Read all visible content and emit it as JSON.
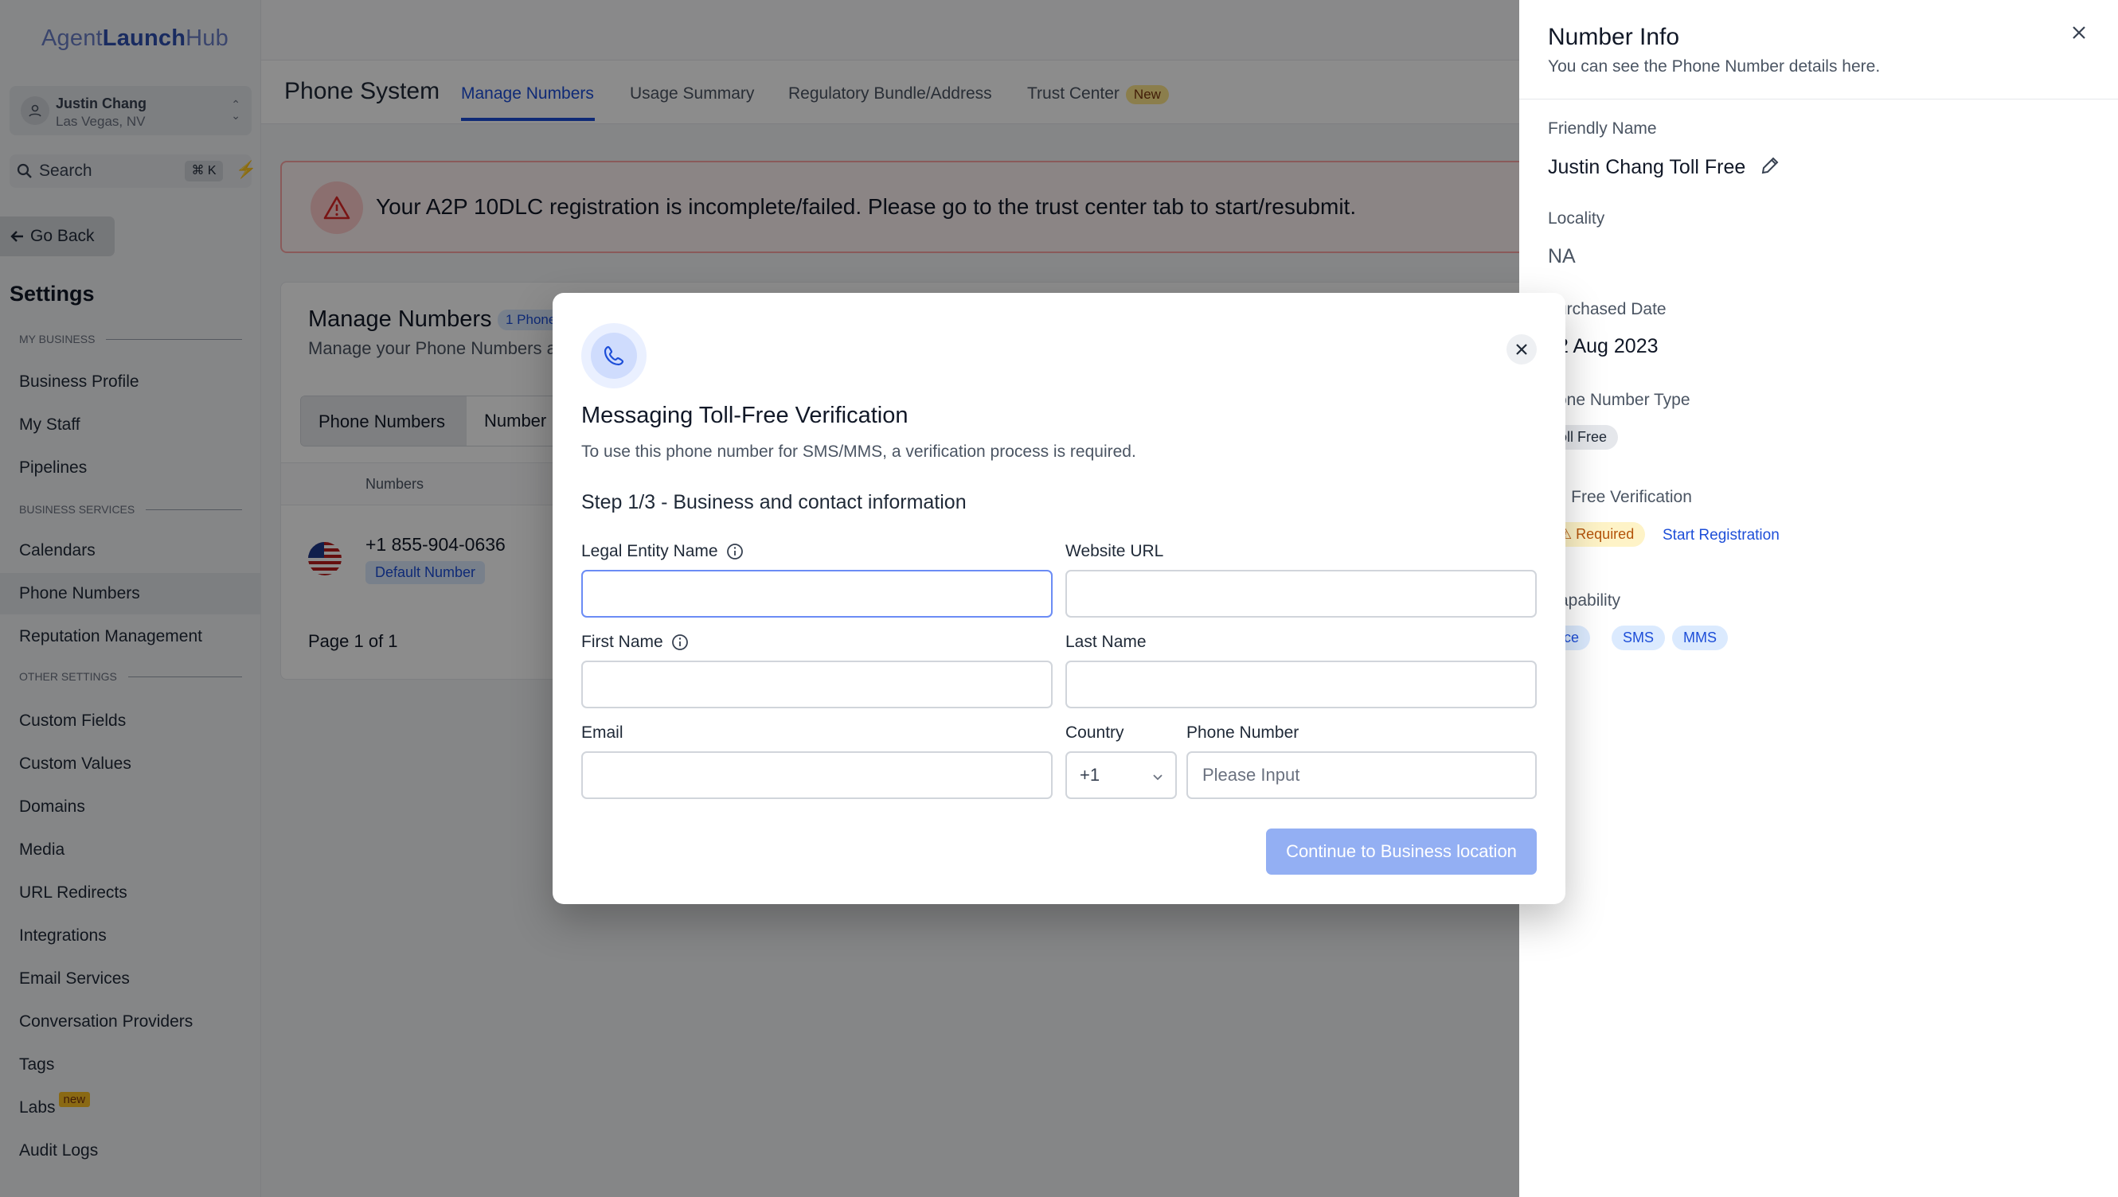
{
  "sidebar": {
    "logo_prefix": "Agent",
    "logo_strong": "Launch",
    "logo_suffix": "Hub",
    "account": {
      "name": "Justin Chang",
      "location": "Las Vegas, NV"
    },
    "search": {
      "label": "Search",
      "shortcut": "⌘ K"
    },
    "go_back": "Go Back",
    "title": "Settings",
    "sections": {
      "my_business": "MY BUSINESS",
      "business_services": "BUSINESS SERVICES",
      "other_settings": "OTHER SETTINGS"
    },
    "items": {
      "business_profile": "Business Profile",
      "my_staff": "My Staff",
      "pipelines": "Pipelines",
      "calendars": "Calendars",
      "phone_numbers": "Phone Numbers",
      "reputation": "Reputation Management",
      "custom_fields": "Custom Fields",
      "custom_values": "Custom Values",
      "domains": "Domains",
      "media": "Media",
      "url_redirects": "URL Redirects",
      "integrations": "Integrations",
      "email_services": "Email Services",
      "conversation_providers": "Conversation Providers",
      "tags": "Tags",
      "labs": "Labs",
      "labs_badge": "new",
      "audit_logs": "Audit Logs"
    }
  },
  "header": {
    "title": "Phone System",
    "tabs": {
      "manage": "Manage Numbers",
      "usage": "Usage Summary",
      "regulatory": "Regulatory Bundle/Address",
      "trust": "Trust Center",
      "trust_badge": "New"
    }
  },
  "alert": "Your A2P 10DLC registration is incomplete/failed. Please go to the trust center tab to start/resubmit.",
  "card": {
    "title": "Manage Numbers",
    "count": "1 Phone",
    "subtitle": "Manage your Phone Numbers a",
    "tab_phone_numbers": "Phone Numbers",
    "tab_number": "Number",
    "col_numbers": "Numbers",
    "row_number": "+1 855-904-0636",
    "row_badge": "Default Number",
    "pager": "Page 1 of 1"
  },
  "drawer": {
    "title": "Number Info",
    "subtitle": "You can see the Phone Number details here.",
    "friendly_label": "Friendly Name",
    "friendly_value": "Justin Chang Toll Free",
    "locality_label": "Locality",
    "locality_value": "NA",
    "purchased_label": "urchased Date",
    "purchased_value": "2 Aug 2023",
    "type_label": "one Number Type",
    "type_value": "oll Free",
    "verification_label": "ll Free Verification",
    "verification_status": "Required",
    "start_registration": "Start Registration",
    "capability_label": "apability",
    "capabilities": [
      "oice",
      "SMS",
      "MMS"
    ]
  },
  "modal": {
    "title": "Messaging Toll-Free Verification",
    "description": "To use this phone number for SMS/MMS, a verification process is required.",
    "step": "Step 1/3 - Business and contact information",
    "fields": {
      "legal_entity": {
        "label": "Legal Entity Name",
        "value": ""
      },
      "website": {
        "label": "Website URL",
        "value": ""
      },
      "first_name": {
        "label": "First Name",
        "value": ""
      },
      "last_name": {
        "label": "Last Name",
        "value": ""
      },
      "email": {
        "label": "Email",
        "value": ""
      },
      "country": {
        "label": "Country",
        "value": "+1"
      },
      "phone": {
        "label": "Phone Number",
        "placeholder": "Please Input"
      }
    },
    "continue_button": "Continue to Business location"
  },
  "colors": {
    "primary": "#1d4ed8",
    "button_disabled": "#93aff3",
    "alert_border": "#fca5a5",
    "warning": "#b45309"
  },
  "icons": [
    "user-icon",
    "search-icon",
    "bolt-icon",
    "arrow-left-icon",
    "warning-icon",
    "phone-icon",
    "close-icon",
    "info-icon",
    "chevron-down-icon",
    "pencil-icon",
    "us-flag-icon"
  ]
}
